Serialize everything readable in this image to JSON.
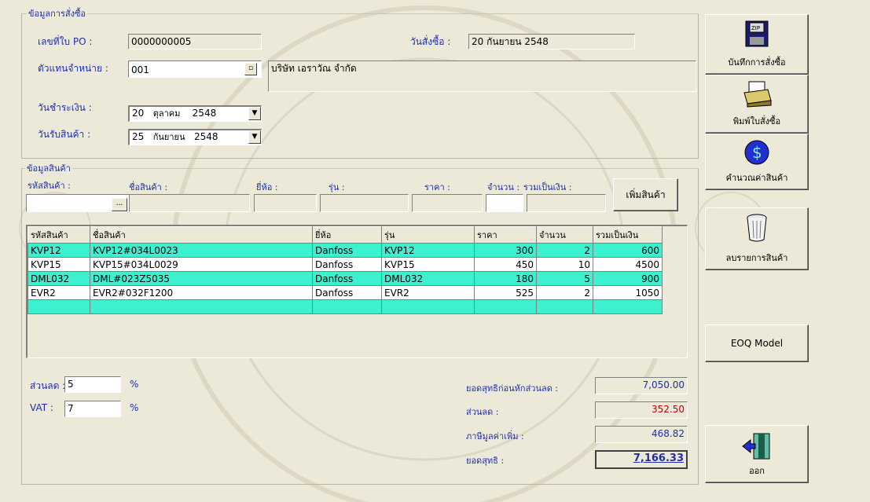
{
  "po_info": {
    "legend": "ข้อมูลการสั่งซื้อ",
    "po_label": "เลขที่ใบ PO :",
    "po_value": "0000000005",
    "order_date_label": "วันสั่งซื้อ :",
    "order_date_value": "20 กันยายน 2548",
    "dealer_label": "ตัวแทนจำหน่าย :",
    "dealer_code": "001",
    "dealer_name": "บริษัท เอราวัณ จำกัด",
    "pay_date_label": "วันชำระเงิน :",
    "pay_date": {
      "day": "20",
      "month": "ตุลาคม",
      "year": "2548"
    },
    "receive_date_label": "วันรับสินค้า :",
    "receive_date": {
      "day": "25",
      "month": "กันยายน",
      "year": "2548"
    }
  },
  "product_info": {
    "legend": "ข้อมูลสินค้า",
    "code_label": "รหัสสินค้า :",
    "name_label": "ชื่อสินค้า :",
    "brand_label": "ยี่ห้อ :",
    "model_label": "รุ่น :",
    "price_label": "ราคา :",
    "qty_label": "จำนวน :",
    "total_label": "รวมเป็นเงิน :",
    "add_button": "เพิ่มสินค้า",
    "browse": "..."
  },
  "grid": {
    "headers": [
      "รหัสสินค้า",
      "ชื่อสินค้า",
      "ยี่ห้อ",
      "รุ่น",
      "ราคา",
      "จำนวน",
      "รวมเป็นเงิน"
    ],
    "rows": [
      [
        "KVP12",
        "KVP12#034L0023",
        "Danfoss",
        "KVP12",
        "300",
        "2",
        "600"
      ],
      [
        "KVP15",
        "KVP15#034L0029",
        "Danfoss",
        "KVP15",
        "450",
        "10",
        "4500"
      ],
      [
        "DML032",
        "DML#023Z5035",
        "Danfoss",
        "DML032",
        "180",
        "5",
        "900"
      ],
      [
        "EVR2",
        "EVR2#032F1200",
        "Danfoss",
        "EVR2",
        "525",
        "2",
        "1050"
      ],
      [
        "",
        "",
        "",
        "",
        "",
        "",
        ""
      ]
    ]
  },
  "summary": {
    "discount_label": "ส่วนลด :",
    "discount_value": "5",
    "vat_label": "VAT :",
    "vat_value": "7",
    "percent": "%",
    "subtotal_label": "ยอดสุทธิก่อนหักส่วนลด :",
    "subtotal": "7,050.00",
    "discount_amount_label": "ส่วนลด :",
    "discount_amount": "352.50",
    "vat_amount_label": "ภาษีมูลค่าเพิ่ม :",
    "vat_amount": "468.82",
    "net_label": "ยอดสุทธิ :",
    "net": "7,166.33"
  },
  "side_buttons": {
    "save": "บันทึกการสั่งซื้อ",
    "print": "พิมพ์ใบสั่งซื้อ",
    "calc": "คำนวณค่าสินค้า",
    "delete": "ลบรายการสินค้า",
    "eoq": "EOQ Model",
    "exit": "ออก"
  },
  "colors": {
    "row_highlight": "#3df0d0",
    "label_blue": "#1f2fa8",
    "discount_red": "#c00000",
    "net_blue": "#1f2fa8"
  }
}
